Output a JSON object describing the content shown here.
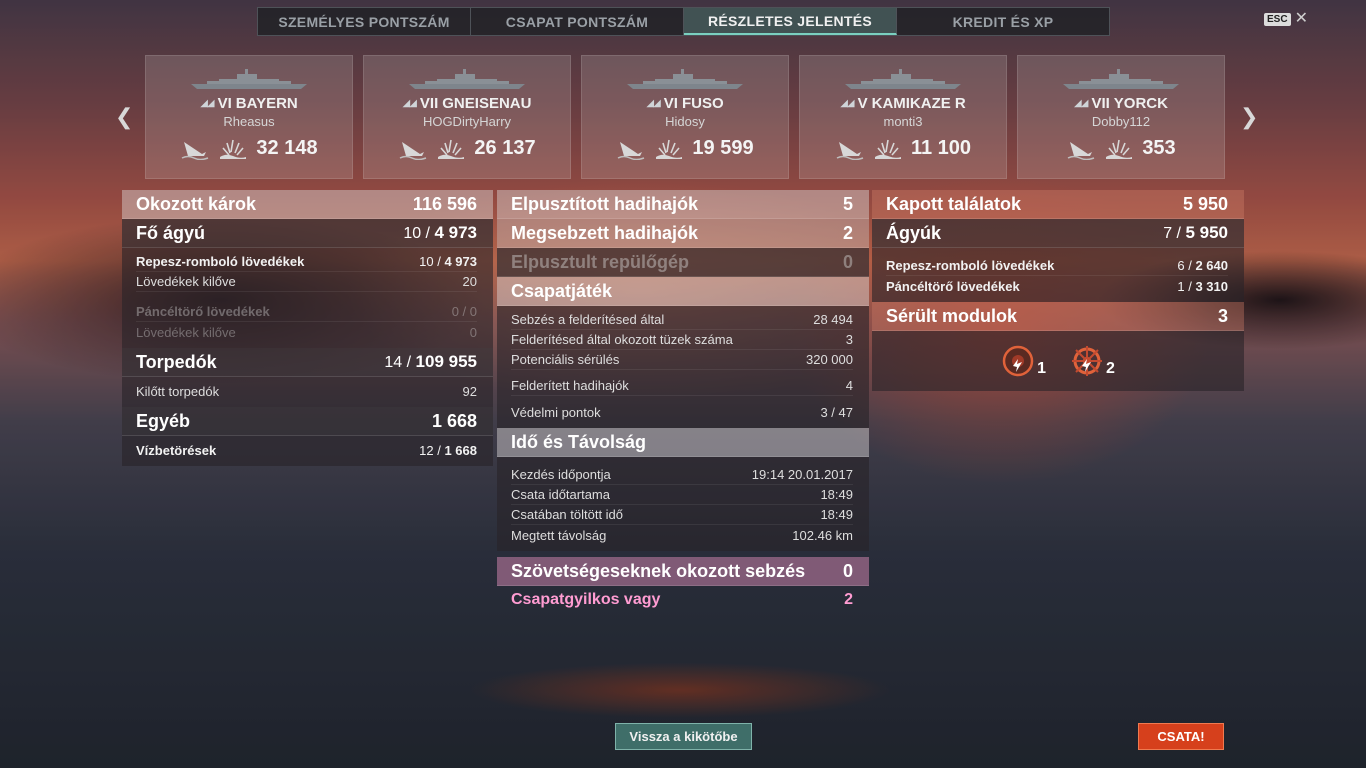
{
  "tabs": [
    "SZEMÉLYES PONTSZÁM",
    "CSAPAT PONTSZÁM",
    "RÉSZLETES JELENTÉS",
    "KREDIT ÉS XP"
  ],
  "active_tab": 2,
  "esc_label": "ESC",
  "ships": [
    {
      "tier": "VI",
      "name": "BAYERN",
      "player": "Rheasus",
      "damage": "32 148",
      "class_icon": "battleship-icon"
    },
    {
      "tier": "VII",
      "name": "GNEISENAU",
      "player": "HOGDirtyHarry",
      "damage": "26 137",
      "class_icon": "battleship-icon"
    },
    {
      "tier": "VI",
      "name": "FUSO",
      "player": "Hidosy",
      "damage": "19 599",
      "class_icon": "battleship-icon"
    },
    {
      "tier": "V",
      "name": "KAMIKAZE R",
      "player": "monti3",
      "damage": "11 100",
      "class_icon": "destroyer-icon"
    },
    {
      "tier": "VII",
      "name": "YORCK",
      "player": "Dobby112",
      "damage": "353",
      "class_icon": "cruiser-icon"
    }
  ],
  "damage_dealt": {
    "title": "Okozott károk",
    "total": "116 596",
    "main_battery": {
      "label": "Fő ágyú",
      "hits": "10",
      "damage": "4 973"
    },
    "he": {
      "label": "Repesz-romboló lövedékek",
      "hits": "10",
      "damage": "4 973"
    },
    "he_fired": {
      "label": "Lövedékek kilőve",
      "value": "20"
    },
    "ap": {
      "label": "Páncéltörő lövedékek",
      "hits": "0",
      "damage": "0"
    },
    "ap_fired": {
      "label": "Lövedékek kilőve",
      "value": "0"
    },
    "torpedoes": {
      "label": "Torpedók",
      "hits": "14",
      "damage": "109 955"
    },
    "torps_fired": {
      "label": "Kilőtt torpedók",
      "value": "92"
    },
    "other": {
      "label": "Egyéb",
      "value": "1 668"
    },
    "flooding": {
      "label": "Vízbetörések",
      "hits": "12",
      "damage": "1 668"
    }
  },
  "middle": {
    "destroyed": {
      "label": "Elpusztított hadihajók",
      "value": "5"
    },
    "damaged": {
      "label": "Megsebzett hadihajók",
      "value": "2"
    },
    "planes": {
      "label": "Elpusztult repülőgép",
      "value": "0"
    },
    "teamplay": {
      "title": "Csapatjáték",
      "rows": [
        {
          "label": "Sebzés a felderítésed által",
          "value": "28 494"
        },
        {
          "label": "Felderítésed által okozott tüzek száma",
          "value": "3"
        },
        {
          "label": "Potenciális sérülés",
          "value": "320 000"
        },
        {
          "label": "Felderített hadihajók",
          "value": "4"
        },
        {
          "label": "Védelmi pontok",
          "value": "3 / 47"
        }
      ]
    },
    "time": {
      "title": "Idő és Távolság",
      "rows": [
        {
          "label": "Kezdés időpontja",
          "value": "19:14  20.01.2017"
        },
        {
          "label": "Csata időtartama",
          "value": "18:49"
        },
        {
          "label": "Csatában töltött idő",
          "value": "18:49"
        },
        {
          "label": "Megtett távolság",
          "value": "102.46 km"
        }
      ]
    },
    "ally_damage": {
      "label": "Szövetségeseknek okozott sebzés",
      "value": "0"
    },
    "teamkiller": {
      "label": "Csapatgyilkos vagy",
      "value": "2"
    }
  },
  "received": {
    "title": "Kapott találatok",
    "total": "5 950",
    "guns": {
      "label": "Ágyúk",
      "hits": "7",
      "damage": "5 950"
    },
    "he": {
      "label": "Repesz-romboló lövedékek",
      "hits": "6",
      "damage": "2 640"
    },
    "ap": {
      "label": "Páncéltörő lövedékek",
      "hits": "1",
      "damage": "3 310"
    },
    "modules": {
      "label": "Sérült modulok",
      "value": "3",
      "items": [
        {
          "icon": "engine-damage-icon",
          "count": "1"
        },
        {
          "icon": "steering-damage-icon",
          "count": "2"
        }
      ]
    }
  },
  "buttons": {
    "port": "Vissza a kikötőbe",
    "battle": "CSATA!"
  },
  "colors": {
    "battle_button": "#d6401c",
    "port_button": "#3f6e69",
    "teamkill_pink": "#ff9cd2"
  }
}
